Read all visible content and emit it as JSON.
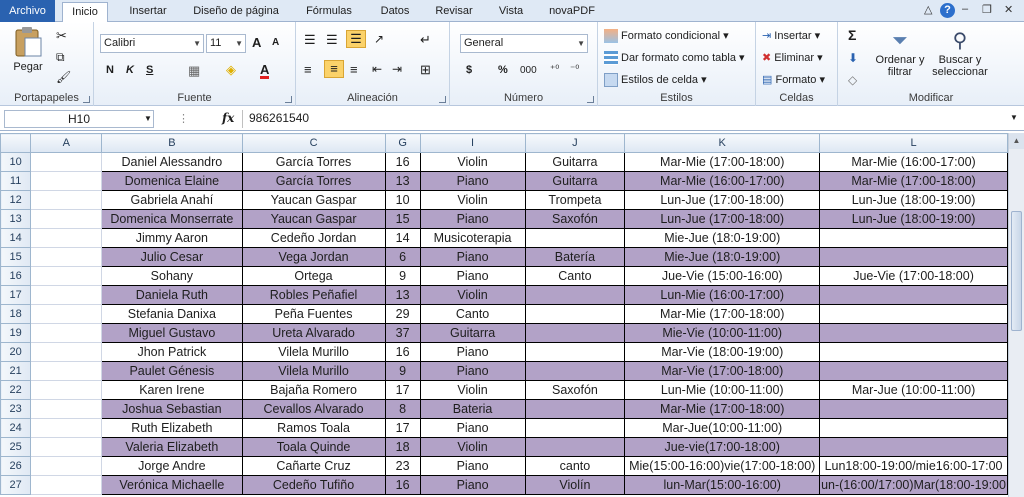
{
  "tabs": [
    "Archivo",
    "Inicio",
    "Insertar",
    "Diseño de página",
    "Fórmulas",
    "Datos",
    "Revisar",
    "Vista",
    "novaPDF"
  ],
  "ribbon": {
    "clipboard": {
      "paste": "Pegar",
      "label": "Portapapeles"
    },
    "font": {
      "name": "Calibri",
      "size": "11",
      "bold": "N",
      "italic": "K",
      "underline": "S",
      "grow": "A",
      "shrink": "A",
      "color_a": "A",
      "label": "Fuente"
    },
    "alignment": {
      "label": "Alineación"
    },
    "number": {
      "format": "General",
      "currency": "$",
      "percent": "%",
      "thousands": "000",
      "label": "Número"
    },
    "styles": {
      "conditional": "Formato condicional",
      "table": "Dar formato como tabla",
      "cell": "Estilos de celda",
      "label": "Estilos"
    },
    "cells": {
      "insert": "Insertar",
      "delete": "Eliminar",
      "format": "Formato",
      "label": "Celdas"
    },
    "editing": {
      "sigma": "Σ",
      "sort": "Ordenar y filtrar",
      "find": "Buscar y seleccionar",
      "label": "Modificar"
    }
  },
  "formula_bar": {
    "name_box": "H10",
    "fx": "fx",
    "value": "986261540"
  },
  "columns": [
    "A",
    "B",
    "C",
    "G",
    "I",
    "J",
    "K",
    "L"
  ],
  "rows": [
    {
      "n": "10",
      "alt": false,
      "cells": [
        "",
        "Daniel Alessandro",
        "García Torres",
        "16",
        "Violin",
        "Guitarra",
        "Mar-Mie (17:00-18:00)",
        "Mar-Mie (16:00-17:00)"
      ]
    },
    {
      "n": "11",
      "alt": true,
      "cells": [
        "",
        "Domenica Elaine",
        "García Torres",
        "13",
        "Piano",
        "Guitarra",
        "Mar-Mie (16:00-17:00)",
        "Mar-Mie (17:00-18:00)"
      ]
    },
    {
      "n": "12",
      "alt": false,
      "cells": [
        "",
        "Gabriela Anahí",
        "Yaucan Gaspar",
        "10",
        "Violin",
        "Trompeta",
        "Lun-Jue (17:00-18:00)",
        "Lun-Jue (18:00-19:00)"
      ]
    },
    {
      "n": "13",
      "alt": true,
      "cells": [
        "",
        "Domenica Monserrate",
        "Yaucan Gaspar",
        "15",
        "Piano",
        "Saxofón",
        "Lun-Jue (17:00-18:00)",
        "Lun-Jue (18:00-19:00)"
      ]
    },
    {
      "n": "14",
      "alt": false,
      "cells": [
        "",
        "Jimmy Aaron",
        "Cedeño Jordan",
        "14",
        "Musicoterapia",
        "",
        "Mie-Jue (18:0-19:00)",
        ""
      ]
    },
    {
      "n": "15",
      "alt": true,
      "cells": [
        "",
        "Julio Cesar",
        "Vega Jordan",
        "6",
        "Piano",
        "Batería",
        "Mie-Jue (18:0-19:00)",
        ""
      ]
    },
    {
      "n": "16",
      "alt": false,
      "cells": [
        "",
        "Sohany",
        "Ortega",
        "9",
        "Piano",
        "Canto",
        "Jue-Vie (15:00-16:00)",
        "Jue-Vie (17:00-18:00)"
      ]
    },
    {
      "n": "17",
      "alt": true,
      "cells": [
        "",
        "Daniela Ruth",
        "Robles Peñafiel",
        "13",
        "Violin",
        "",
        "Lun-Mie (16:00-17:00)",
        ""
      ]
    },
    {
      "n": "18",
      "alt": false,
      "cells": [
        "",
        "Stefania Danixa",
        "Peña Fuentes",
        "29",
        "Canto",
        "",
        "Mar-Mie (17:00-18:00)",
        ""
      ]
    },
    {
      "n": "19",
      "alt": true,
      "cells": [
        "",
        "Miguel Gustavo",
        "Ureta Alvarado",
        "37",
        "Guitarra",
        "",
        "Mie-Vie (10:00-11:00)",
        ""
      ]
    },
    {
      "n": "20",
      "alt": false,
      "cells": [
        "",
        "Jhon Patrick",
        "Vilela Murillo",
        "16",
        "Piano",
        "",
        "Mar-Vie (18:00-19:00)",
        ""
      ]
    },
    {
      "n": "21",
      "alt": true,
      "cells": [
        "",
        "Paulet Génesis",
        "Vilela Murillo",
        "9",
        "Piano",
        "",
        "Mar-Vie (17:00-18:00)",
        ""
      ]
    },
    {
      "n": "22",
      "alt": false,
      "cells": [
        "",
        "Karen Irene",
        "Bajaña Romero",
        "17",
        "Violin",
        "Saxofón",
        "Lun-Mie (10:00-11:00)",
        "Mar-Jue (10:00-11:00)"
      ]
    },
    {
      "n": "23",
      "alt": true,
      "cells": [
        "",
        "Joshua Sebastian",
        "Cevallos Alvarado",
        "8",
        "Bateria",
        "",
        "Mar-Mie (17:00-18:00)",
        ""
      ]
    },
    {
      "n": "24",
      "alt": false,
      "cells": [
        "",
        "Ruth Elizabeth",
        "Ramos Toala",
        "17",
        "Piano",
        "",
        "Mar-Jue(10:00-11:00)",
        ""
      ]
    },
    {
      "n": "25",
      "alt": true,
      "cells": [
        "",
        "Valeria Elizabeth",
        "Toala Quinde",
        "18",
        "Violin",
        "",
        "Jue-vie(17:00-18:00)",
        ""
      ]
    },
    {
      "n": "26",
      "alt": false,
      "cells": [
        "",
        "Jorge Andre",
        "Cañarte Cruz",
        "23",
        "Piano",
        "canto",
        "Mie(15:00-16:00)vie(17:00-18:00)",
        "Lun18:00-19:00/mie16:00-17:00"
      ]
    },
    {
      "n": "27",
      "alt": true,
      "cells": [
        "",
        "Verónica Michaelle",
        "Cedeño Tufiño",
        "16",
        "Piano",
        "Violín",
        "lun-Mar(15:00-16:00)",
        "un-(16:00/17:00)Mar(18:00-19:00"
      ]
    }
  ],
  "colors": {
    "accent": "#2a62b0",
    "row_fill": "#b2a2c7"
  }
}
